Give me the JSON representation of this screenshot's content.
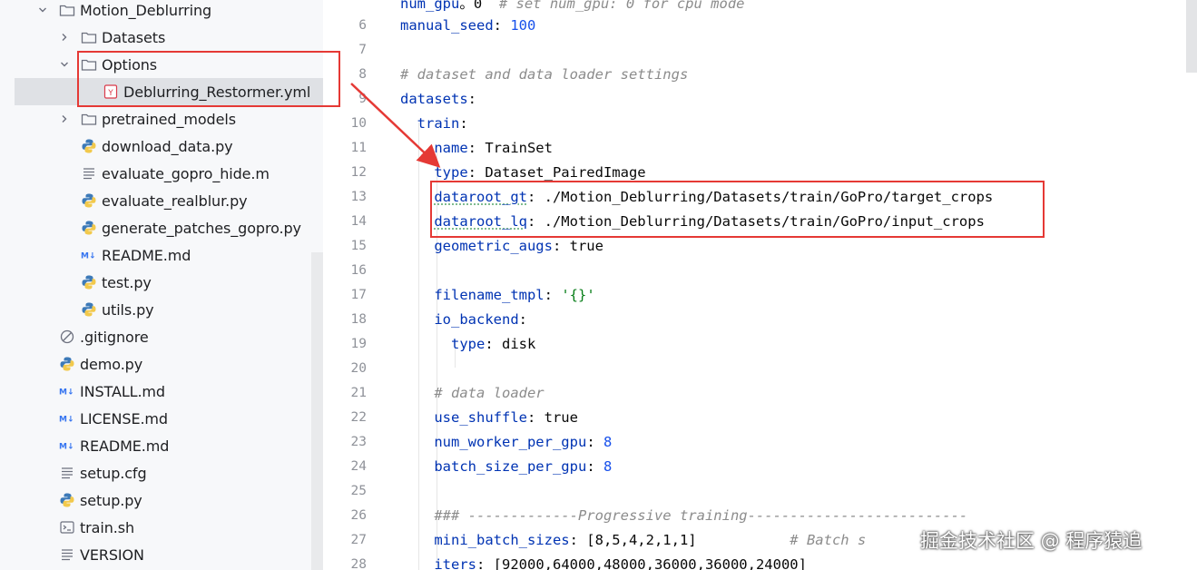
{
  "tree": {
    "items": [
      {
        "label": "Motion_Deblurring",
        "icon": "folder-icon",
        "chevron": "down"
      },
      {
        "label": "Datasets",
        "icon": "folder-icon",
        "chevron": "right"
      },
      {
        "label": "Options",
        "icon": "folder-icon",
        "chevron": "down"
      },
      {
        "label": "Deblurring_Restormer.yml",
        "icon": "yaml-file-icon",
        "selected": true
      },
      {
        "label": "pretrained_models",
        "icon": "folder-icon",
        "chevron": "right"
      },
      {
        "label": "download_data.py",
        "icon": "python-file-icon"
      },
      {
        "label": "evaluate_gopro_hide.m",
        "icon": "text-file-icon"
      },
      {
        "label": "evaluate_realblur.py",
        "icon": "python-file-icon"
      },
      {
        "label": "generate_patches_gopro.py",
        "icon": "python-file-icon"
      },
      {
        "label": "README.md",
        "icon": "markdown-file-icon"
      },
      {
        "label": "test.py",
        "icon": "python-file-icon"
      },
      {
        "label": "utils.py",
        "icon": "python-file-icon"
      },
      {
        "label": ".gitignore",
        "icon": "ignore-file-icon"
      },
      {
        "label": "demo.py",
        "icon": "python-file-icon"
      },
      {
        "label": "INSTALL.md",
        "icon": "markdown-file-icon"
      },
      {
        "label": "LICENSE.md",
        "icon": "markdown-file-icon"
      },
      {
        "label": "README.md",
        "icon": "markdown-file-icon"
      },
      {
        "label": "setup.cfg",
        "icon": "text-file-icon"
      },
      {
        "label": "setup.py",
        "icon": "python-file-icon"
      },
      {
        "label": "train.sh",
        "icon": "shell-file-icon"
      },
      {
        "label": "VERSION",
        "icon": "text-file-icon"
      }
    ]
  },
  "editor": {
    "lines": [
      {
        "num": "",
        "parts": [
          [
            "k",
            "num_gpu"
          ],
          [
            "",
            "。"
          ],
          [
            "",
            "0"
          ],
          [
            "",
            "  "
          ],
          [
            "c",
            "# set num_gpu: 0 for cpu mode"
          ]
        ]
      },
      {
        "num": "6",
        "parts": [
          [
            "k",
            "manual_seed"
          ],
          [
            "",
            ": "
          ],
          [
            "n",
            "100"
          ]
        ]
      },
      {
        "num": "7",
        "parts": []
      },
      {
        "num": "8",
        "parts": [
          [
            "c",
            "# dataset and data loader settings"
          ]
        ]
      },
      {
        "num": "9",
        "parts": [
          [
            "k",
            "datasets"
          ],
          [
            "",
            ":"
          ]
        ]
      },
      {
        "num": "10",
        "parts": [
          [
            "",
            "  "
          ],
          [
            "k",
            "train"
          ],
          [
            "",
            ":"
          ]
        ]
      },
      {
        "num": "11",
        "parts": [
          [
            "",
            "    "
          ],
          [
            "k",
            "name"
          ],
          [
            "",
            ": TrainSet"
          ]
        ]
      },
      {
        "num": "12",
        "parts": [
          [
            "",
            "    "
          ],
          [
            "k",
            "type"
          ],
          [
            "",
            ": Dataset_PairedImage"
          ]
        ]
      },
      {
        "num": "13",
        "parts": [
          [
            "",
            "    "
          ],
          [
            "ku",
            "dataroot_gt"
          ],
          [
            "",
            ": ./Motion_Deblurring/Datasets/train/GoPro/target_crops"
          ]
        ]
      },
      {
        "num": "14",
        "parts": [
          [
            "",
            "    "
          ],
          [
            "ku",
            "dataroot_lq"
          ],
          [
            "",
            ": ./Motion_Deblurring/Datasets/train/GoPro/input_crops"
          ]
        ]
      },
      {
        "num": "15",
        "parts": [
          [
            "",
            "    "
          ],
          [
            "k",
            "geometric_augs"
          ],
          [
            "",
            ": true"
          ]
        ]
      },
      {
        "num": "16",
        "parts": []
      },
      {
        "num": "17",
        "parts": [
          [
            "",
            "    "
          ],
          [
            "k",
            "filename_tmpl"
          ],
          [
            "",
            ": "
          ],
          [
            "s",
            "'{}'"
          ]
        ]
      },
      {
        "num": "18",
        "parts": [
          [
            "",
            "    "
          ],
          [
            "k",
            "io_backend"
          ],
          [
            "",
            ":"
          ]
        ]
      },
      {
        "num": "19",
        "parts": [
          [
            "",
            "      "
          ],
          [
            "k",
            "type"
          ],
          [
            "",
            ": disk"
          ]
        ]
      },
      {
        "num": "20",
        "parts": []
      },
      {
        "num": "21",
        "parts": [
          [
            "",
            "    "
          ],
          [
            "c",
            "# data loader"
          ]
        ]
      },
      {
        "num": "22",
        "parts": [
          [
            "",
            "    "
          ],
          [
            "k",
            "use_shuffle"
          ],
          [
            "",
            ": true"
          ]
        ]
      },
      {
        "num": "23",
        "parts": [
          [
            "",
            "    "
          ],
          [
            "k",
            "num_worker_per_gpu"
          ],
          [
            "",
            ": "
          ],
          [
            "n",
            "8"
          ]
        ]
      },
      {
        "num": "24",
        "parts": [
          [
            "",
            "    "
          ],
          [
            "k",
            "batch_size_per_gpu"
          ],
          [
            "",
            ": "
          ],
          [
            "n",
            "8"
          ]
        ]
      },
      {
        "num": "25",
        "parts": []
      },
      {
        "num": "26",
        "parts": [
          [
            "",
            "    "
          ],
          [
            "c",
            "### -------------Progressive training--------------------------"
          ]
        ]
      },
      {
        "num": "27",
        "parts": [
          [
            "",
            "    "
          ],
          [
            "k",
            "mini_batch_sizes"
          ],
          [
            "",
            ": [8,5,4,2,1,1]"
          ],
          [
            "",
            "           "
          ],
          [
            "c",
            "# Batch s"
          ]
        ]
      },
      {
        "num": "28",
        "parts": [
          [
            "",
            "    "
          ],
          [
            "k",
            "iters"
          ],
          [
            "",
            ": [92000,64000,48000,36000,36000,24000]"
          ]
        ]
      }
    ]
  },
  "watermark": "掘金技术社区 @ 程序猿追",
  "colors": {
    "annotation": "#e53935",
    "keyword": "#0033b3",
    "comment": "#8c8c8c",
    "selection": "#dfe1e5"
  }
}
